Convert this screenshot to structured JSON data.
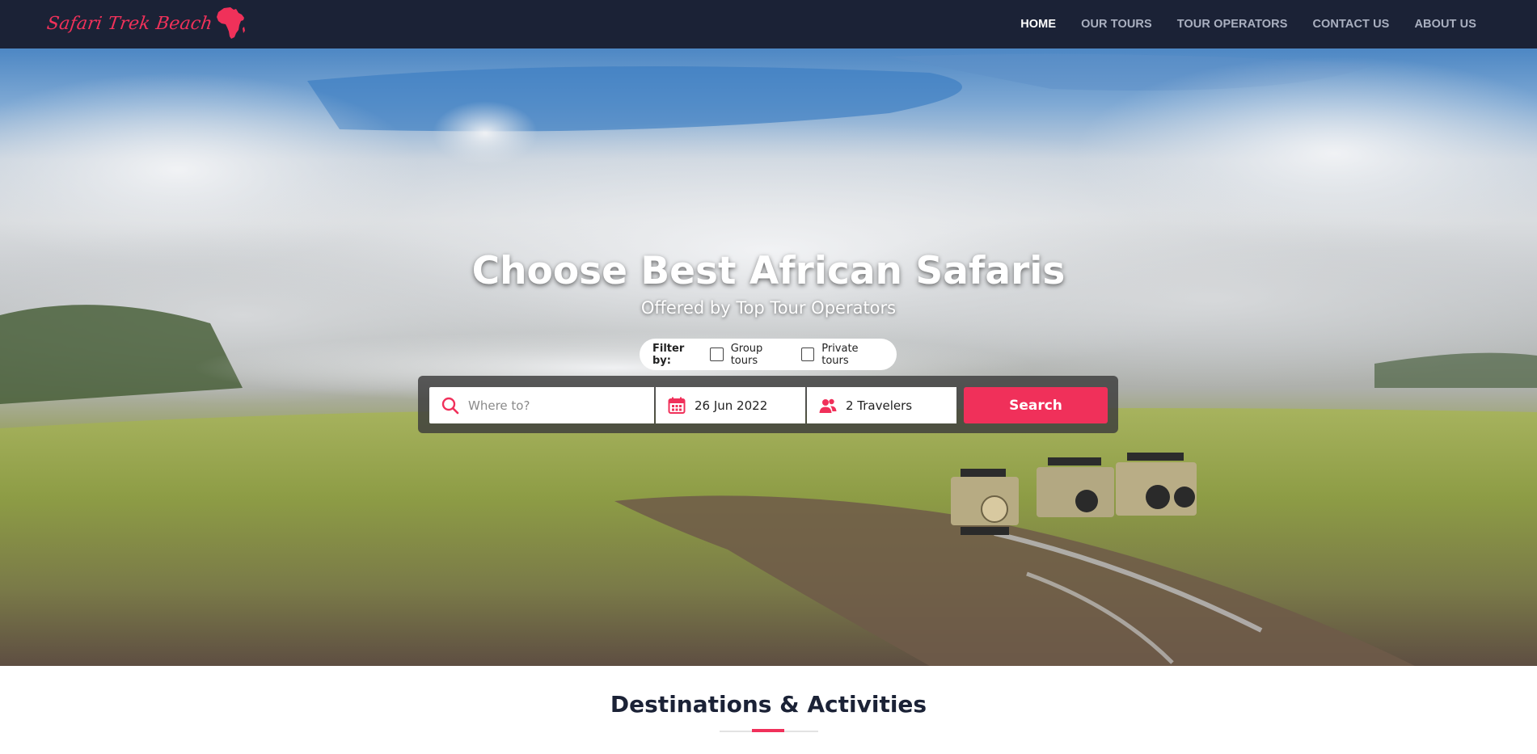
{
  "brand": {
    "name": "Safari Trek Beach",
    "accent_color": "#f0305a",
    "nav_bg": "#1b2236"
  },
  "nav": {
    "items": [
      {
        "label": "HOME",
        "active": true
      },
      {
        "label": "OUR TOURS",
        "active": false
      },
      {
        "label": "TOUR OPERATORS",
        "active": false
      },
      {
        "label": "CONTACT US",
        "active": false
      },
      {
        "label": "ABOUT US",
        "active": false
      }
    ]
  },
  "hero": {
    "title": "Choose Best African Safaris",
    "subtitle": "Offered by Top Tour Operators",
    "background": "safari landscape with vehicles and clouds"
  },
  "filter": {
    "label": "Filter by:",
    "options": [
      {
        "label": "Group tours",
        "checked": false
      },
      {
        "label": "Private tours",
        "checked": false
      }
    ]
  },
  "search": {
    "where_placeholder": "Where to?",
    "where_value": "",
    "date": "26 Jun 2022",
    "travelers": "2 Travelers",
    "button_label": "Search",
    "icons": {
      "where": "search-icon",
      "date": "calendar-icon",
      "travelers": "users-icon"
    }
  },
  "section": {
    "title": "Destinations & Activities"
  }
}
